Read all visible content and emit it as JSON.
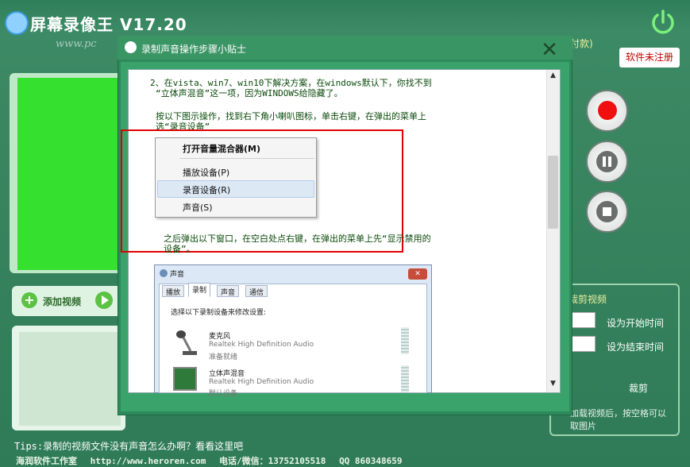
{
  "app": {
    "title": "屏幕录像王 V17.20",
    "watermark": "www.pc",
    "pay_text": "付款)",
    "unregistered_label": "软件未注册"
  },
  "left_panel": {
    "add_video_label": "添加视频"
  },
  "right_panel": {
    "cut_video_label": "裁剪视频",
    "set_start_label": "设为开始时间",
    "set_end_label": "设为结束时间",
    "cut_button": "裁剪",
    "hint": "加载视频后，按空格可以 取图片"
  },
  "bottom": {
    "tips": "Tips:录制的视频文件没有声音怎么办啊？看看这里吧",
    "footer_company": "海润软件工作室",
    "footer_url": "http://www.heroren.com",
    "footer_phone": "电话/微信：13752105518",
    "footer_qq": "QQ 860348659"
  },
  "dialog": {
    "title": "录制声音操作步骤小贴士",
    "close_symbol": "✕",
    "para1_line1": "2、在vista、win7、win10下解决方案，在windows默认下，你找不到",
    "para1_line2": "“立体声混音”这一项，因为WINDOWS给隐藏了。",
    "para2_line1": "按以下图示操作，找到右下角小喇叭图标，单击右键，在弹出的菜单上",
    "para2_line2": "选“录音设备”",
    "para3_line1": "之后弹出以下窗口，在空白处点右键，在弹出的菜单上先“显示禁用的",
    "para3_line2": "设备”。",
    "context_menu": {
      "items": [
        "打开音量混合器(M)",
        "播放设备(P)",
        "录音设备(R)",
        "声音(S)"
      ]
    },
    "sound_dialog": {
      "title": "声音",
      "tabs": [
        "播放",
        "录制",
        "声音",
        "通信"
      ],
      "description": "选择以下录制设备来修改设置:",
      "devices": [
        {
          "name": "麦克风",
          "driver": "Realtek High Definition Audio",
          "status": "准备就绪"
        },
        {
          "name": "立体声混音",
          "driver": "Realtek High Definition Audio",
          "status": "默认设备"
        }
      ]
    }
  },
  "colors": {
    "background": "#3a8762",
    "preview_green": "#35e02e",
    "record_red": "#f01010",
    "highlight_red": "#e00000",
    "instruction_text": "#0a4a0a"
  }
}
